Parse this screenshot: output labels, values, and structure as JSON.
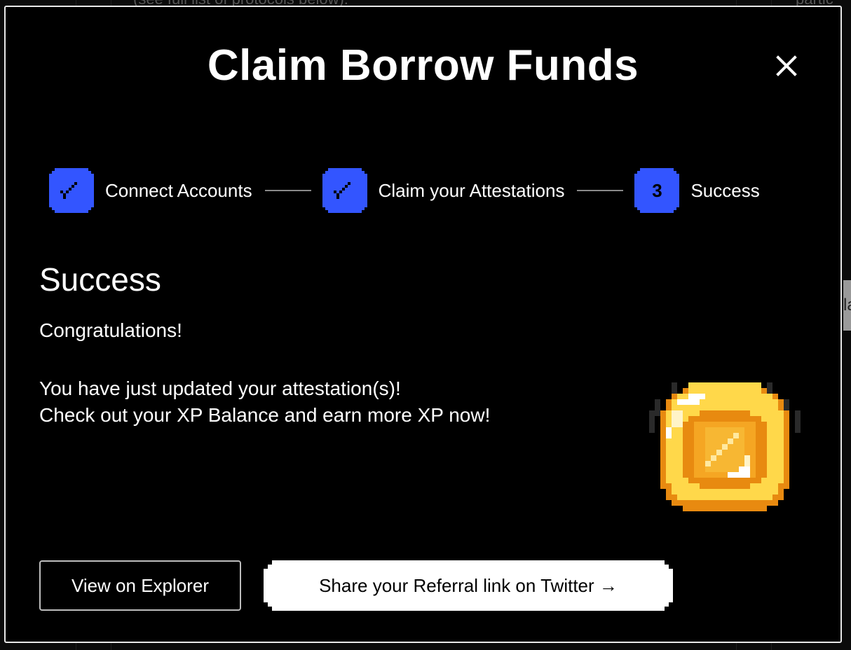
{
  "background": {
    "top_left_text": "(see full list of protocols below).",
    "top_right_text": "partic",
    "side_chip_text": "la"
  },
  "modal": {
    "title": "Claim Borrow Funds",
    "close_icon": "close-icon",
    "steps": [
      {
        "label": "Connect Accounts",
        "state": "complete",
        "icon": "check-icon"
      },
      {
        "label": "Claim your Attestations",
        "state": "complete",
        "icon": "check-icon"
      },
      {
        "label": "Success",
        "state": "current",
        "number": "3"
      }
    ],
    "section_title": "Success",
    "congrats": "Congratulations!",
    "message_line1": "You have just updated your attestation(s)!",
    "message_line2": "Check out your XP Balance and earn more XP now!",
    "coin_icon": "xp-coin-icon",
    "buttons": {
      "explorer": "View on Explorer",
      "share": "Share your Referral link on Twitter →"
    }
  },
  "colors": {
    "step_blue": "#3355ff",
    "modal_bg": "#000000",
    "text": "#ffffff",
    "coin_gold": "#f5c02c",
    "coin_orange": "#e88a10",
    "coin_light": "#ffe066"
  }
}
